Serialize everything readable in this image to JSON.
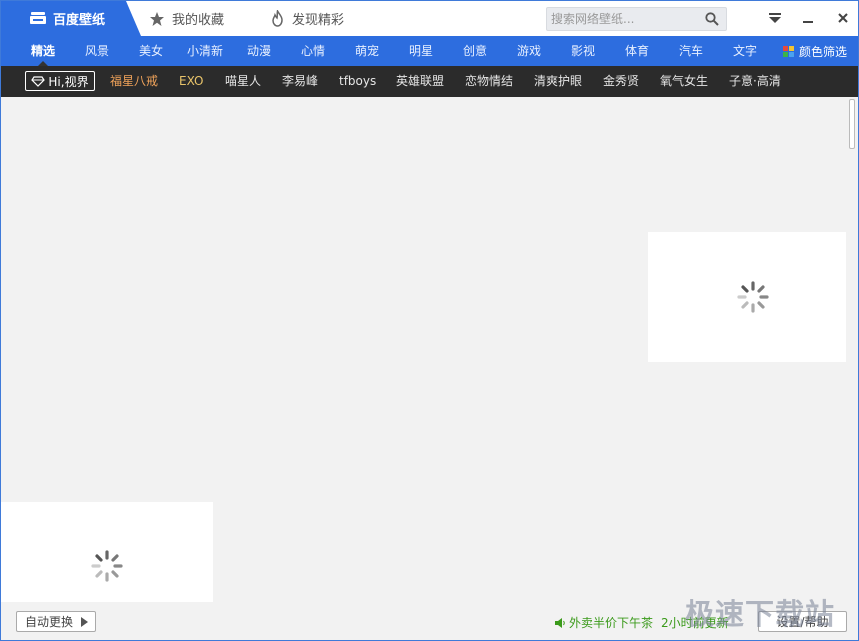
{
  "app": {
    "title": "百度壁纸",
    "tabs": [
      {
        "label": "我的收藏",
        "icon": "star-icon"
      },
      {
        "label": "发现精彩",
        "icon": "fire-icon"
      }
    ]
  },
  "search": {
    "placeholder": "搜索网络壁纸..."
  },
  "window_controls": [
    "menu-icon",
    "minimize-icon",
    "close-icon"
  ],
  "categories": {
    "active": "精选",
    "items": [
      "精选",
      "风景",
      "美女",
      "小清新",
      "动漫",
      "心情",
      "萌宠",
      "明星",
      "创意",
      "游戏",
      "影视",
      "体育",
      "汽车",
      "文字"
    ],
    "color_filter": "颜色筛选"
  },
  "tags": {
    "hi_button": "Hi,视界",
    "items": [
      "福星八戒",
      "EXO",
      "喵星人",
      "李易峰",
      "tfboys",
      "英雄联盟",
      "恋物情结",
      "清爽护眼",
      "金秀贤",
      "氧气女生",
      "子意·高清"
    ]
  },
  "status": {
    "auto_change": "自动更换",
    "promo": "外卖半价下午茶",
    "promo_time": "2小时前更新",
    "settings": "设置/帮助"
  },
  "watermark": "极速下载站",
  "colors": {
    "brand_blue": "#2d6ddf",
    "tag_bar": "#2b2b2b",
    "hot_tag": "#f0a35a",
    "gold_tag": "#e9c46a",
    "promo_green": "#3a9a1a"
  }
}
